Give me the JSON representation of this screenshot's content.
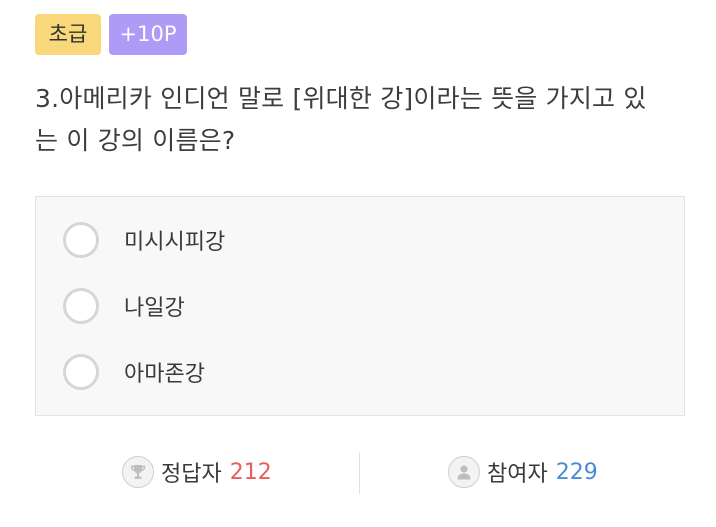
{
  "badges": {
    "level": "초급",
    "points": "+10P"
  },
  "question": {
    "line1": "3.아메리카 인디언 말로 [위대한 강]이라는 뜻을 가지고 있",
    "line2": "는 이 강의 이름은?"
  },
  "options": [
    {
      "label": "미시시피강"
    },
    {
      "label": "나일강"
    },
    {
      "label": "아마존강"
    }
  ],
  "stats": {
    "correct_label": "정답자",
    "correct_count": "212",
    "participants_label": "참여자",
    "participants_count": "229",
    "correct_icon": "trophy-icon",
    "participants_icon": "person-icon"
  },
  "colors": {
    "level_badge": "#f9d77b",
    "points_badge": "#ad9bf5",
    "correct_count": "#e85d5d",
    "participants_count": "#4a8ad6"
  }
}
